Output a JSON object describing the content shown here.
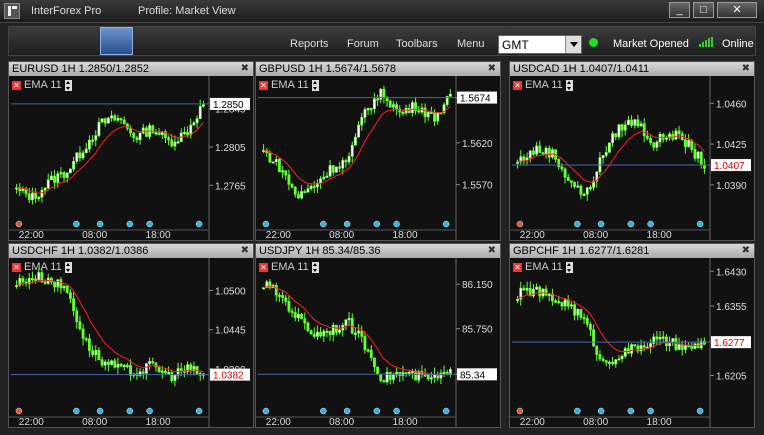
{
  "window": {
    "app_title": "InterForex Pro",
    "profile": "Profile: Market View",
    "buttons": [
      "_",
      "□",
      "✕"
    ]
  },
  "toolbar": {
    "menu": [
      "Reports",
      "Forum",
      "Toolbars",
      "Menu"
    ],
    "timezone": "GMT",
    "market_status": "Market Opened",
    "connection": "Online",
    "colors": {
      "status": "#22dd22",
      "accent_tab": "#3e66a8"
    },
    "icons": [
      "app-logo-icon",
      "status-dot-icon",
      "signal-bars-icon",
      "chevron-down-icon"
    ]
  },
  "chart_data": [
    {
      "type": "candlestick",
      "title": "EURUSD 1H 1.2850/1.2852",
      "indicator": "EMA",
      "indicator_period": "11",
      "yticks": [
        "1.2845",
        "1.2805",
        "1.2765"
      ],
      "ylim": [
        1.2735,
        1.2875
      ],
      "last_price": "1.2850",
      "xticks": [
        "22:00",
        "08:00",
        "18:00"
      ],
      "trend": [
        1.276,
        1.2752,
        1.277,
        1.278,
        1.2805,
        1.283,
        1.2835,
        1.2815,
        1.2825,
        1.281,
        1.282,
        1.285
      ],
      "close_color": "#ffffff",
      "ema_color": "#ff2020",
      "candle_color": "#66ff33"
    },
    {
      "type": "candlestick",
      "title": "GBPUSD 1H 1.5674/1.5678",
      "indicator": "EMA",
      "indicator_period": "11",
      "yticks": [
        "1.5674",
        "1.5620",
        "1.5570"
      ],
      "ylim": [
        1.5535,
        1.5695
      ],
      "last_price": "1.5674",
      "xticks": [
        "22:00",
        "08:00",
        "18:00"
      ],
      "trend": [
        1.561,
        1.559,
        1.5555,
        1.557,
        1.559,
        1.56,
        1.566,
        1.568,
        1.5655,
        1.5665,
        1.565,
        1.5674
      ],
      "close_color": "#ffffff",
      "ema_color": "#ff2020",
      "candle_color": "#66ff33"
    },
    {
      "type": "candlestick",
      "title": "USDCAD 1H 1.0407/1.0411",
      "indicator": "EMA",
      "indicator_period": "11",
      "yticks": [
        "1.0460",
        "1.0425",
        "1.0390"
      ],
      "ylim": [
        1.0365,
        1.048
      ],
      "last_price": "1.0407",
      "xticks": [
        "22:00",
        "08:00",
        "18:00"
      ],
      "trend": [
        1.041,
        1.042,
        1.0418,
        1.0395,
        1.038,
        1.0415,
        1.044,
        1.0445,
        1.0425,
        1.0435,
        1.0425,
        1.0407
      ],
      "close_color": "#ff2020",
      "ema_color": "#ff2020",
      "candle_color": "#66ff33"
    },
    {
      "type": "candlestick",
      "title": "USDCHF 1H 1.0382/1.0386",
      "indicator": "EMA",
      "indicator_period": "11",
      "yticks": [
        "1.0500",
        "1.0445",
        "1.0390"
      ],
      "ylim": [
        1.0345,
        1.054
      ],
      "last_price": "1.0382",
      "xticks": [
        "22:00",
        "08:00",
        "18:00"
      ],
      "trend": [
        1.051,
        1.052,
        1.0515,
        1.05,
        1.043,
        1.04,
        1.039,
        1.0385,
        1.0395,
        1.038,
        1.039,
        1.0382
      ],
      "close_color": "#ff2020",
      "ema_color": "#ff2020",
      "candle_color": "#66ff33"
    },
    {
      "type": "candlestick",
      "title": "USDJPY 1H 85.34/85.36",
      "indicator": "EMA",
      "indicator_period": "11",
      "yticks": [
        "86.150",
        "85.750",
        "85.340"
      ],
      "ylim": [
        85.1,
        86.35
      ],
      "last_price": "85.34",
      "xticks": [
        "22:00",
        "08:00",
        "18:00"
      ],
      "trend": [
        86.15,
        86.05,
        85.85,
        85.7,
        85.75,
        85.8,
        85.6,
        85.3,
        85.35,
        85.32,
        85.3,
        85.34
      ],
      "close_color": "#ffffff",
      "ema_color": "#ff2020",
      "candle_color": "#66ff33"
    },
    {
      "type": "candlestick",
      "title": "GBPCHF 1H 1.6277/1.6281",
      "indicator": "EMA",
      "indicator_period": "11",
      "yticks": [
        "1.6430",
        "1.6355",
        "1.6277",
        "1.6205"
      ],
      "ylim": [
        1.615,
        1.645
      ],
      "last_price": "1.6277",
      "xticks": [
        "22:00",
        "08:00",
        "18:00"
      ],
      "trend": [
        1.638,
        1.639,
        1.637,
        1.636,
        1.632,
        1.623,
        1.625,
        1.6265,
        1.628,
        1.6275,
        1.626,
        1.6277
      ],
      "close_color": "#ff2020",
      "ema_color": "#ff2020",
      "candle_color": "#66ff33"
    }
  ]
}
